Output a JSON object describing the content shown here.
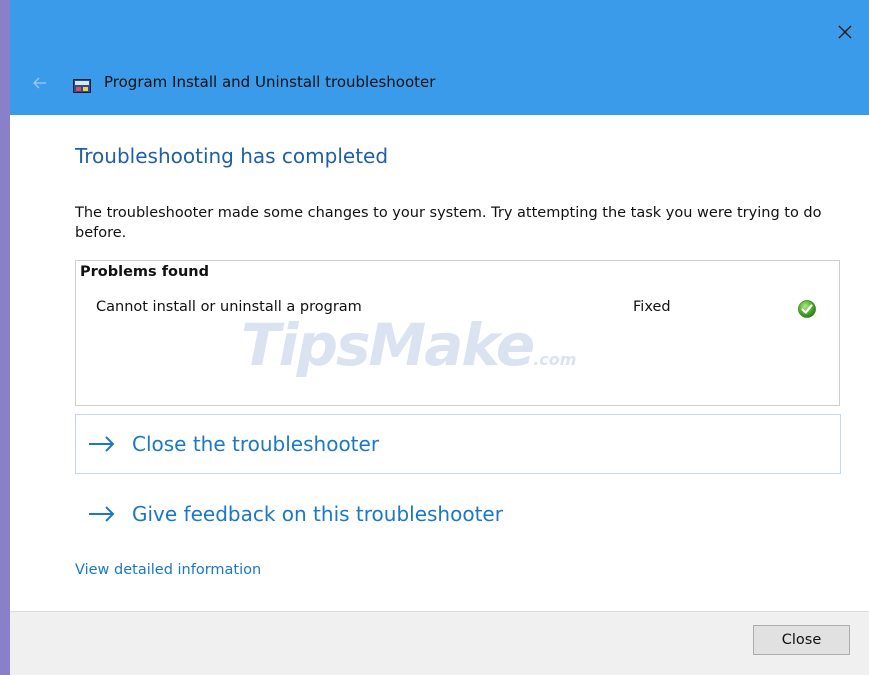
{
  "window": {
    "title": "Program Install and Uninstall troubleshooter",
    "accent_color": "#3a9bea"
  },
  "main": {
    "heading": "Troubleshooting has completed",
    "description": "The troubleshooter made some changes to your system. Try attempting the task you were trying to do before."
  },
  "problems": {
    "header": "Problems found",
    "items": [
      {
        "name": "Cannot install or uninstall a program",
        "status": "Fixed",
        "icon": "green-check-icon"
      }
    ]
  },
  "watermark": {
    "main": "TipsMake",
    "suffix": ".com"
  },
  "links": {
    "close_troubleshooter": "Close the troubleshooter",
    "give_feedback": "Give feedback on this troubleshooter",
    "view_details": "View detailed information"
  },
  "footer": {
    "close_label": "Close"
  }
}
